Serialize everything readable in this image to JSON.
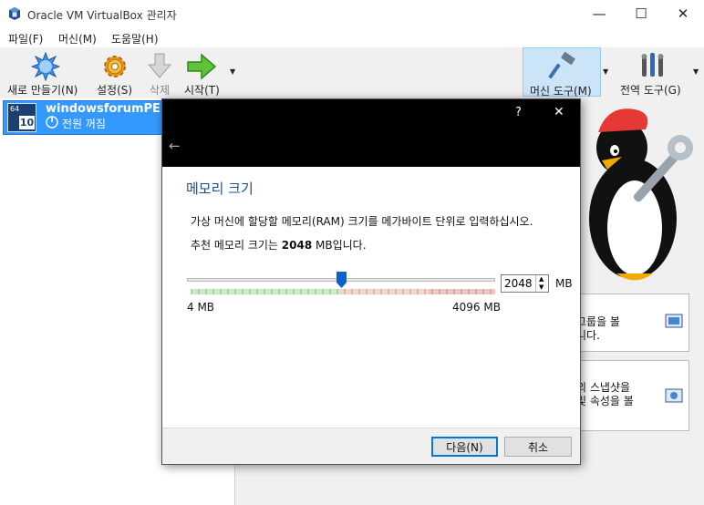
{
  "window": {
    "title": "Oracle VM VirtualBox 관리자",
    "minimize": "—",
    "maximize": "☐",
    "close": "✕"
  },
  "menu": [
    "파일(F)",
    "머신(M)",
    "도움말(H)"
  ],
  "toolbar": {
    "new_label": "새로 만들기(N)",
    "settings_label": "설정(S)",
    "discard_label": "삭제",
    "start_label": "시작(T)",
    "machine_tools_label": "머신 도구(M)",
    "global_tools_label": "전역 도구(G)"
  },
  "vm": {
    "os_badge_top": "64",
    "os_badge_num": "10",
    "name": "windowsforumPE",
    "state": "전원 꺼짐"
  },
  "right_panel": {
    "box1_lines": [
      "그룹을 볼",
      "니다."
    ],
    "box2_lines": [
      "의 스냅샷을",
      "및 속성을 볼",
      "."
    ]
  },
  "dialog": {
    "help": "?",
    "close": "✕",
    "back": "←",
    "title": "메모리 크기",
    "desc": "가상 머신에 할당할 메모리(RAM) 크기를 메가바이트 단위로 입력하십시오.",
    "rec_prefix": "추천 메모리 크기는 ",
    "rec_value": "2048",
    "rec_suffix": " MB입니다.",
    "memory_value": "2048",
    "unit": "MB",
    "slider_min_label": "4 MB",
    "slider_max_label": "4096 MB",
    "slider_fraction": 0.5,
    "next_label": "다음(N)",
    "cancel_label": "취소"
  },
  "colors": {
    "selection": "#3399ff",
    "accent": "#0078d7",
    "dialog_title": "#1a4f8a",
    "scale_green": "#c8efc0",
    "scale_orange": "#f8d5c6",
    "scale_red": "#f5c4c4"
  }
}
